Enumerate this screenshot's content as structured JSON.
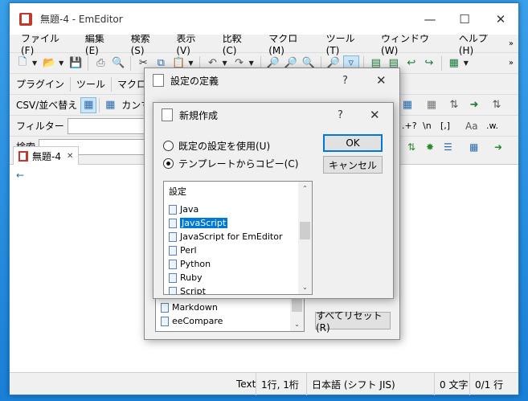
{
  "window": {
    "title": "無題-4 - EmEditor"
  },
  "menu": [
    "ファイル(F)",
    "編集(E)",
    "検索(S)",
    "表示(V)",
    "比較(C)",
    "マクロ(M)",
    "ツール(T)",
    "ウィンドウ(W)",
    "ヘルプ(H)"
  ],
  "toolbar2": {
    "plugins": "プラグイン",
    "tools": "ツール",
    "macro": "マクロ"
  },
  "toolbar3": {
    "csv": "CSV/並べ替え",
    "comma": "カンマ"
  },
  "filter": {
    "label": "フィルター"
  },
  "search": {
    "label": "検索"
  },
  "tab": {
    "label": "無題-4"
  },
  "status": {
    "mode": "Text",
    "pos": "1行, 1桁",
    "encoding": "日本語 (シフト JIS)",
    "chars": "0 文字",
    "lines": "0/1 行"
  },
  "config_dialog": {
    "title": "設定の定義",
    "list": [
      "Markdown",
      "eeCompare"
    ],
    "reset_all": "すべてリセット(R)"
  },
  "new_dialog": {
    "title": "新規作成",
    "option_default": "既定の設定を使用(U)",
    "option_template": "テンプレートからコピー(C)",
    "ok": "OK",
    "cancel": "キャンセル",
    "list_header": "設定",
    "list": [
      "Java",
      "JavaScript",
      "JavaScript for EmEditor",
      "Perl",
      "Python",
      "Ruby",
      "Script"
    ],
    "selected": "JavaScript"
  }
}
